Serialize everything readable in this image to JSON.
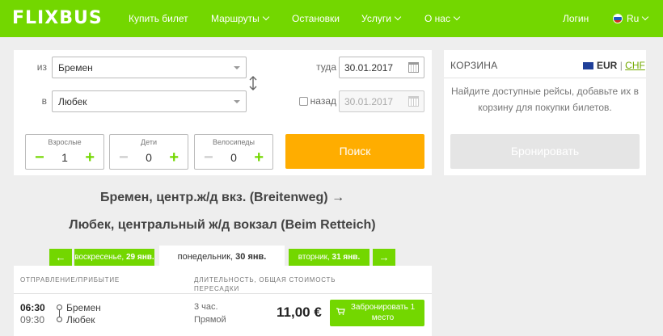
{
  "header": {
    "logo": "FLIXBUS",
    "nav": {
      "buy_ticket": "Купить билет",
      "routes": "Маршруты",
      "stops": "Остановки",
      "services": "Услуги",
      "about": "О нас",
      "login": "Логин",
      "language": "Ru"
    }
  },
  "search": {
    "from_label": "из",
    "from_value": "Бремен",
    "to_label": "в",
    "to_value": "Любек",
    "depart_label": "туда",
    "depart_date": "30.01.2017",
    "return_label": "назад",
    "return_date": "30.01.2017",
    "return_checked": false,
    "adults_label": "Взрослые",
    "adults_value": "1",
    "children_label": "Дети",
    "children_value": "0",
    "bikes_label": "Велосипеды",
    "bikes_value": "0",
    "search_button": "Поиск"
  },
  "cart": {
    "title": "КОРЗИНА",
    "currency_active": "EUR",
    "separator": "|",
    "currency_other": "CHF",
    "message": "Найдите доступные рейсы, добавьте их в корзину для покупки билетов.",
    "book_button": "Бронировать"
  },
  "route": {
    "line1": "Бремен, центр.ж/д вкз. (Breitenweg) →",
    "line2": "Любек, центральный ж/д вокзал (Beim Retteich)"
  },
  "days": {
    "prev_arrow": "←",
    "prev_weekday": "воскресенье,",
    "prev_date": "29 янв.",
    "current_weekday": "понедельник,",
    "current_date": "30 янв.",
    "next_weekday": "вторник,",
    "next_date": "31 янв.",
    "next_arrow": "→"
  },
  "results": {
    "col_departure": "Отправление/прибытие",
    "col_duration_line1": "Длительность, общая стоимость",
    "col_duration_line2": "пересадки",
    "rows": [
      {
        "departure_time": "06:30",
        "arrival_time": "09:30",
        "from_city": "Бремен",
        "to_city": "Любек",
        "duration": "3 час.",
        "transfers": "Прямой",
        "price": "11,00 €",
        "reserve_button": "Забронировать 1 место"
      }
    ]
  },
  "colors": {
    "brand_green": "#73d700",
    "search_orange": "#ffad00",
    "disabled_gray": "#e5e5e5"
  },
  "icons": [
    "logo",
    "chevron-down-icon",
    "russian-flag-icon",
    "calendar-icon",
    "swap-icon",
    "eu-flag-icon",
    "cart-icon"
  ]
}
